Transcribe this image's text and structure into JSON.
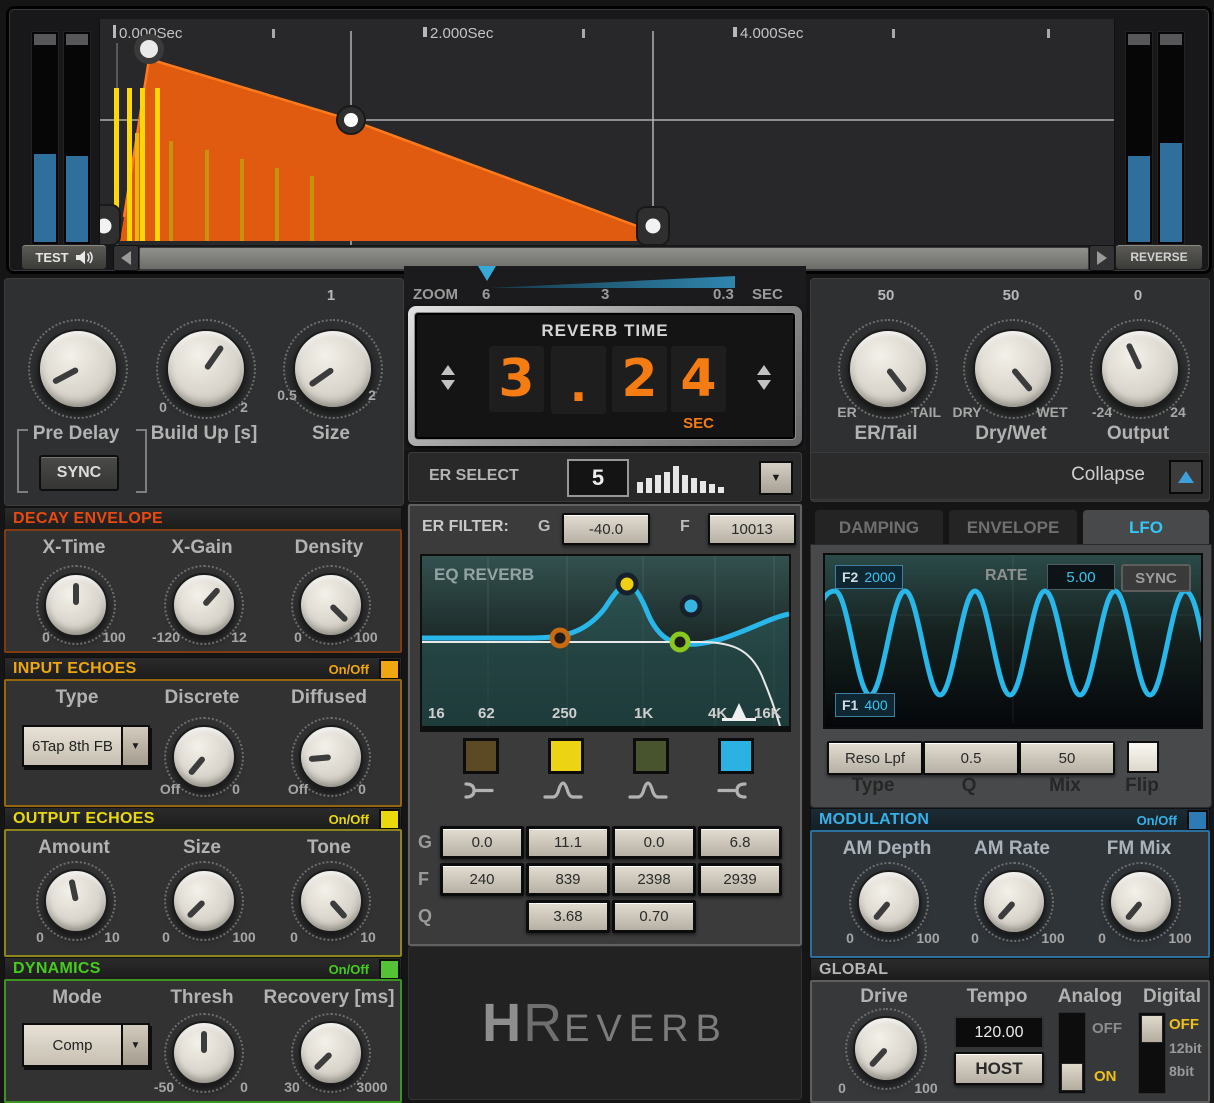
{
  "colors": {
    "decay": "#e8490f",
    "input": "#f0a60f",
    "output": "#e8d80c",
    "dynamics": "#46cc1e",
    "modulation": "#33ace4",
    "envelope_orange": "#e85a10",
    "lfo_cyan": "#29b6e8",
    "meter_blue": "#2e6f9c"
  },
  "transport": {
    "test": "TEST",
    "reverse": "REVERSE",
    "ruler": [
      "0.000Sec",
      "2.000Sec",
      "4.000Sec"
    ]
  },
  "zoom": {
    "label": "ZOOM",
    "t1": "6",
    "t2": "3",
    "t3": "0.3",
    "unit": "SEC"
  },
  "reverb_time": {
    "title": "REVERB TIME",
    "d1": "3",
    "d2": ".",
    "d3": "2",
    "d4": "4",
    "unit": "SEC",
    "value": "3.24"
  },
  "er_select": {
    "label": "ER SELECT",
    "value": "5"
  },
  "mid": {
    "er_filter_label": "ER FILTER:",
    "g_label": "G",
    "g_value": "-40.0",
    "f_label": "F",
    "f_value": "10013",
    "eq_title": "EQ REVERB",
    "freqs": [
      "16",
      "62",
      "250",
      "1K",
      "4K",
      "16K"
    ],
    "row_g": "G",
    "row_f": "F",
    "row_q": "Q",
    "g_cells": [
      "0.0",
      "11.1",
      "0.0",
      "6.8"
    ],
    "f_cells": [
      "240",
      "839",
      "2398",
      "2939"
    ],
    "q_cells": [
      "3.68",
      "0.70"
    ]
  },
  "logo": {
    "h": "H",
    "r": "R",
    "rest": "EVERB"
  },
  "left_top": {
    "knobs": [
      {
        "label": "Pre Delay"
      },
      {
        "label": "Build Up [s]",
        "min": "0",
        "max": "2"
      },
      {
        "label": "Size",
        "min": "0.5",
        "max": "2",
        "top": "1"
      }
    ],
    "sync": "SYNC"
  },
  "decay": {
    "title": "DECAY ENVELOPE",
    "knobs": [
      {
        "label": "X-Time",
        "min": "0",
        "max": "100"
      },
      {
        "label": "X-Gain",
        "min": "-120",
        "max": "12"
      },
      {
        "label": "Density",
        "min": "0",
        "max": "100"
      }
    ]
  },
  "input": {
    "title": "INPUT ECHOES",
    "onoff": "On/Off",
    "type_label": "Type",
    "type_value": "6Tap 8th FB",
    "knobs": [
      {
        "label": "Discrete",
        "min": "Off",
        "max": "0"
      },
      {
        "label": "Diffused",
        "min": "Off",
        "max": "0"
      }
    ]
  },
  "output": {
    "title": "OUTPUT ECHOES",
    "onoff": "On/Off",
    "knobs": [
      {
        "label": "Amount",
        "min": "0",
        "max": "10"
      },
      {
        "label": "Size",
        "min": "0",
        "max": "100"
      },
      {
        "label": "Tone",
        "min": "0",
        "max": "10"
      }
    ]
  },
  "dynamics": {
    "title": "DYNAMICS",
    "onoff": "On/Off",
    "mode_label": "Mode",
    "mode_value": "Comp",
    "knobs": [
      {
        "label": "Thresh",
        "min": "-50",
        "max": "0"
      },
      {
        "label": "Recovery [ms]",
        "min": "30",
        "max": "3000"
      }
    ]
  },
  "right_top": {
    "knobs": [
      {
        "label": "ER/Tail",
        "top": "50",
        "min": "ER",
        "max": "TAIL"
      },
      {
        "label": "Dry/Wet",
        "top": "50",
        "min": "DRY",
        "max": "WET"
      },
      {
        "label": "Output",
        "top": "0",
        "min": "-24",
        "max": "24"
      }
    ],
    "collapse": "Collapse"
  },
  "tabs": {
    "damping": "DAMPING",
    "envelope": "ENVELOPE",
    "lfo": "LFO"
  },
  "lfo": {
    "f2_label": "F2",
    "f2_value": "2000",
    "rate_label": "RATE",
    "rate_value": "5.00",
    "sync": "SYNC",
    "f1_label": "F1",
    "f1_value": "400",
    "type_value": "Reso Lpf",
    "q_value": "0.5",
    "mix_value": "50",
    "type_label": "Type",
    "q_label": "Q",
    "mix_label": "Mix",
    "flip_label": "Flip"
  },
  "modulation": {
    "title": "MODULATION",
    "onoff": "On/Off",
    "knobs": [
      {
        "label": "AM Depth",
        "min": "0",
        "max": "100"
      },
      {
        "label": "AM Rate",
        "min": "0",
        "max": "100"
      },
      {
        "label": "FM Mix",
        "min": "0",
        "max": "100"
      }
    ]
  },
  "global": {
    "title": "GLOBAL",
    "drive_label": "Drive",
    "drive_min": "0",
    "drive_max": "100",
    "tempo_label": "Tempo",
    "tempo_value": "120.00",
    "host": "HOST",
    "analog_label": "Analog",
    "analog_off": "OFF",
    "analog_on": "ON",
    "digital_label": "Digital",
    "digital_off": "OFF",
    "digital_12": "12bit",
    "digital_8": "8bit"
  }
}
